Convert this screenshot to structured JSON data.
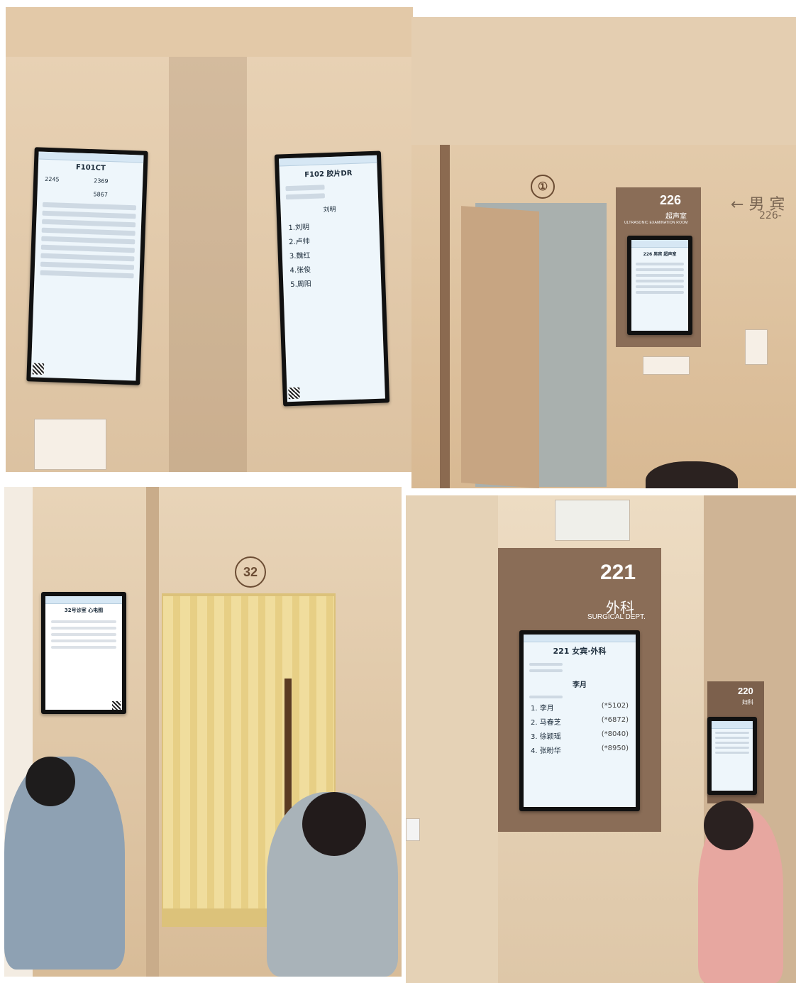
{
  "photos": [
    {
      "id_label": "photo-top-left",
      "screens": [
        {
          "title": "F101CT",
          "cells": [
            "2245",
            "2369",
            "",
            "5867"
          ]
        },
        {
          "title": "F102 胶片DR",
          "queue_name": "刘明",
          "queue": [
            {
              "label": "1.刘明"
            },
            {
              "label": "2.卢帅"
            },
            {
              "label": "3.魏红"
            },
            {
              "label": "4.张俊"
            },
            {
              "label": "5.周阳"
            }
          ]
        }
      ]
    },
    {
      "id_label": "photo-top-right",
      "door_number": "①",
      "room_number": "226",
      "room_name": "超声室",
      "room_name_en": "ULTRASONIC EXAMINATION ROOM",
      "direction_sign": "男 宾",
      "direction_sub": "226-",
      "screen_title": "226 男宾 超声室"
    },
    {
      "id_label": "photo-bottom-left",
      "door_number": "32",
      "screen_title": "32号诊室 心电图"
    },
    {
      "id_label": "photo-bottom-right",
      "room_number": "221",
      "room_name": "外科",
      "room_name_en": "SURGICAL DEPT.",
      "screen_title": "221 女宾·外科",
      "current": "李月",
      "queue": [
        {
          "label": "1. 李月",
          "code": "(*5102)"
        },
        {
          "label": "2. 马春芝",
          "code": "(*6872)"
        },
        {
          "label": "3. 徐颖瑶",
          "code": "(*8040)"
        },
        {
          "label": "4. 张盼华",
          "code": "(*8950)"
        }
      ],
      "adjacent_room_number": "220",
      "adjacent_room_name": "妇科"
    }
  ],
  "colors": {
    "screen_bg": "#eef6fb",
    "wall": "#e6cfb0",
    "trim": "#8b6a50"
  }
}
